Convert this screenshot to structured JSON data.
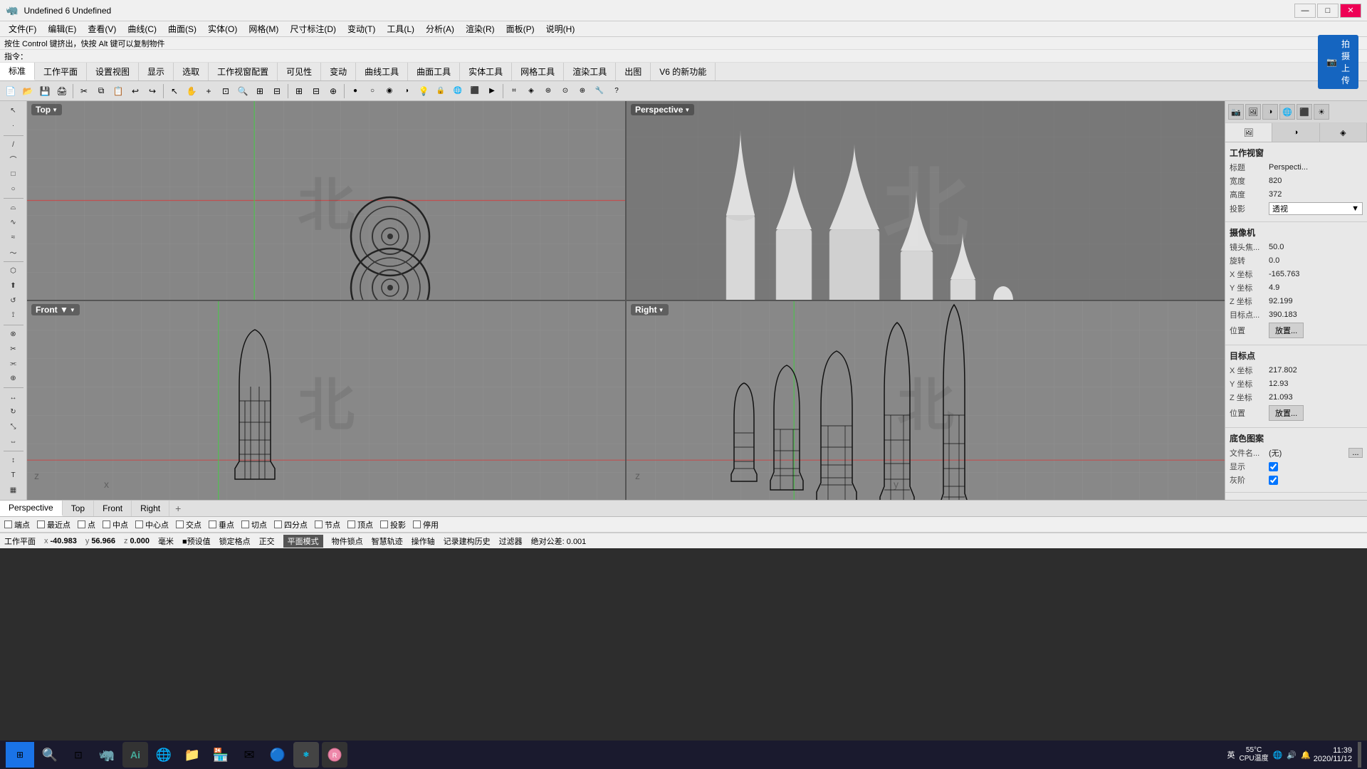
{
  "window": {
    "title": "Undefined 6 Undefined",
    "min_label": "—",
    "max_label": "□",
    "close_label": "✕"
  },
  "menubar": {
    "items": [
      "文件(F)",
      "编辑(E)",
      "查看(V)",
      "曲线(C)",
      "曲面(S)",
      "实体(O)",
      "网格(M)",
      "尺寸标注(D)",
      "变动(T)",
      "工具(L)",
      "分析(A)",
      "渲染(R)",
      "面板(P)",
      "说明(H)"
    ]
  },
  "infobar1": {
    "text": "按住 Control 键挤出，快按 Alt 键可以复制物件"
  },
  "infobar2": {
    "label": "指令："
  },
  "upload_btn": "拍摄上传",
  "tabs": {
    "items": [
      "标准",
      "工作平面",
      "设置视图",
      "显示",
      "选取",
      "工作视窗配置",
      "可见性",
      "变动",
      "曲线工具",
      "曲面工具",
      "实体工具",
      "网格工具",
      "渲染工具",
      "出图",
      "V6 的新功能"
    ]
  },
  "viewports": {
    "top": {
      "label": "Top"
    },
    "perspective": {
      "label": "Perspective"
    },
    "front": {
      "label": "Front"
    },
    "right": {
      "label": "Right"
    }
  },
  "right_panel": {
    "section_viewport": "工作视窗",
    "lbl_title": "标题",
    "val_title": "Perspecti...",
    "lbl_width": "宽度",
    "val_width": "820",
    "lbl_height": "高度",
    "val_height": "372",
    "lbl_projection": "投影",
    "val_projection": "透视",
    "section_camera": "摄像机",
    "lbl_focal": "镜头焦...",
    "val_focal": "50.0",
    "lbl_rotation": "旋转",
    "val_rotation": "0.0",
    "lbl_x": "X 坐标",
    "val_x": "-165.763",
    "lbl_y": "Y 坐标",
    "val_y": "4.9",
    "lbl_z": "Z 坐标",
    "val_z": "92.199",
    "lbl_target_dist": "目标点...",
    "val_target_dist": "390.183",
    "lbl_position": "位置",
    "btn_position": "放置...",
    "section_target": "目标点",
    "lbl_tx": "X 坐标",
    "val_tx": "217.802",
    "lbl_ty": "Y 坐标",
    "val_ty": "12.93",
    "lbl_tz": "Z 坐标",
    "val_tz": "21.093",
    "lbl_tpos": "位置",
    "btn_tpos": "放置...",
    "section_bg": "底色图案",
    "lbl_filename": "文件名...",
    "val_filename": "(无)",
    "btn_browse": "...",
    "lbl_display": "显示",
    "lbl_gray": "灰阶"
  },
  "bottom_tabs": {
    "items": [
      "Perspective",
      "Top",
      "Front",
      "Right"
    ],
    "active": "Perspective",
    "add_label": "+"
  },
  "snapbar": {
    "items": [
      "端点",
      "最近点",
      "点",
      "中点",
      "中心点",
      "交点",
      "垂点",
      "切点",
      "四分点",
      "节点",
      "顶点",
      "投影",
      "停用"
    ]
  },
  "statusbar": {
    "work_plane": "工作平面",
    "x_label": "x",
    "x_val": "-40.983",
    "y_label": "y",
    "y_val": "56.966",
    "z_label": "z",
    "z_val": "0.000",
    "unit": "毫米",
    "preset_label": "■预设值",
    "lock_label": "锁定格点",
    "ortho_label": "正交",
    "plane_mode": "平面模式",
    "obj_snap": "物件锁点",
    "smart_track": "智慧轨迹",
    "op_axis": "操作轴",
    "record_hist": "记录建构历史",
    "filter_label": "过滤器",
    "tolerance": "绝对公差: 0.001"
  },
  "taskbar": {
    "time": "11:39",
    "date": "2020/11/12",
    "lang": "英",
    "temp": "55°C\nCPU温度",
    "ai_label": "Ai"
  }
}
